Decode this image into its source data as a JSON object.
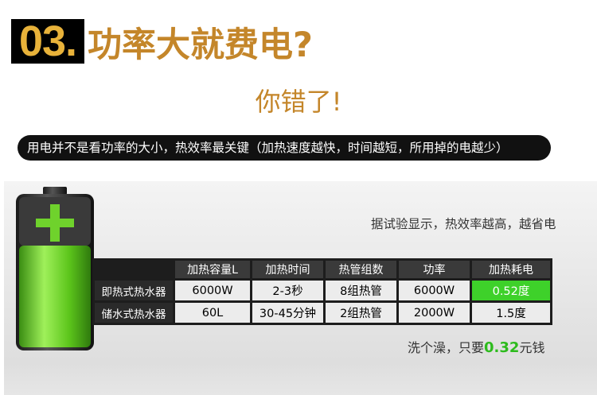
{
  "header": {
    "number": "03.",
    "title": "功率大就费电?",
    "subtitle": "你错了!"
  },
  "banner": {
    "text": "用电并不是看功率的大小，热效率最关键（加热速度越快，时间越短，所用掉的电越少）"
  },
  "note_top": "据试验显示，热效率越高，越省电",
  "table": {
    "headers": [
      "加热容量L",
      "加热时间",
      "热管组数",
      "功率",
      "加热耗电"
    ],
    "rows": [
      {
        "label": "即热式热水器",
        "cells": [
          "6000W",
          "2-3秒",
          "8组热管",
          "6000W",
          "0.52度"
        ]
      },
      {
        "label": "储水式热水器",
        "cells": [
          "60L",
          "30-45分钟",
          "2组热管",
          "2000W",
          "1.5度"
        ]
      }
    ]
  },
  "note_bottom": {
    "before": "洗个澡，只要",
    "highlight": "0.32",
    "after": "元钱"
  },
  "colors": {
    "title": "#c4862a",
    "number": "#e8b23a",
    "highlight_green": "#3ed12a"
  },
  "icons": {
    "battery": "battery-charging-icon"
  }
}
